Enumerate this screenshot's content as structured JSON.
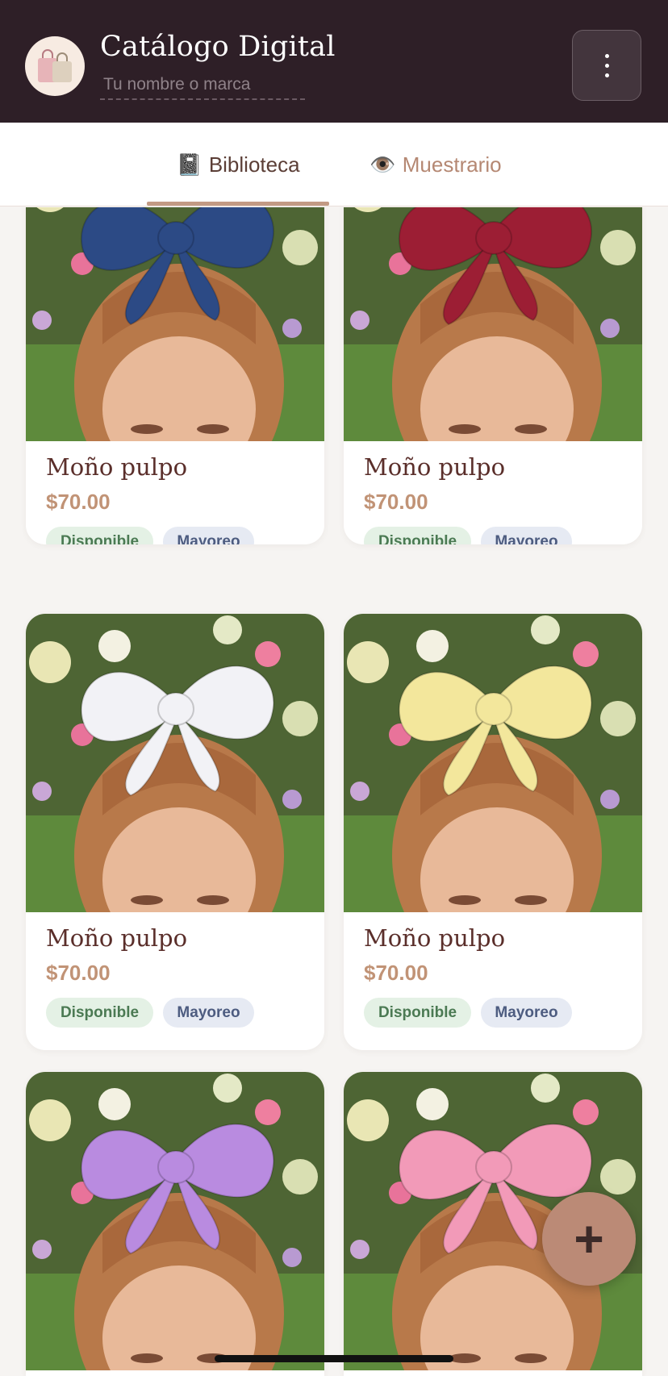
{
  "header": {
    "title": "Catálogo Digital",
    "brand_placeholder": "Tu nombre o marca",
    "logo_icon": "shopping-bags-icon",
    "menu_icon": "more-vertical-icon"
  },
  "tabs": [
    {
      "emoji": "📓",
      "label": "Biblioteca",
      "active": true
    },
    {
      "emoji": "👁️",
      "label": "Muestrario",
      "active": false
    }
  ],
  "products": [
    {
      "name": "Moño pulpo",
      "price": "$70.00",
      "badges": [
        "Disponible",
        "Mayoreo"
      ],
      "bow_color": "#2c4a85"
    },
    {
      "name": "Moño pulpo",
      "price": "$70.00",
      "badges": [
        "Disponible",
        "Mayoreo"
      ],
      "bow_color": "#9c1e34"
    },
    {
      "name": "Moño pulpo",
      "price": "$70.00",
      "badges": [
        "Disponible",
        "Mayoreo"
      ],
      "bow_color": "#f2f2f6"
    },
    {
      "name": "Moño pulpo",
      "price": "$70.00",
      "badges": [
        "Disponible",
        "Mayoreo"
      ],
      "bow_color": "#f3e79c"
    },
    {
      "bow_color": "#b98be0"
    },
    {
      "bow_color": "#f29ab8"
    }
  ],
  "fab": {
    "icon": "plus-icon",
    "label": "+"
  },
  "colors": {
    "header_bg": "#2e1f27",
    "accent": "#bb8a76",
    "price": "#c19376",
    "name": "#5a2e2a"
  }
}
